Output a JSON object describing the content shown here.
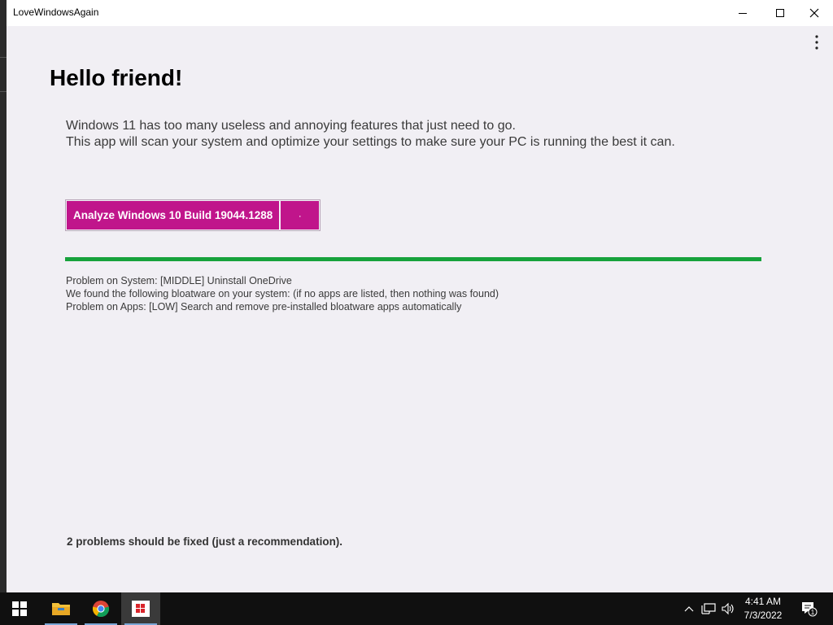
{
  "window": {
    "title": "LoveWindowsAgain"
  },
  "main": {
    "heading": "Hello friend!",
    "intro_line1": "Windows 11 has too many useless and annoying features that just need to go.",
    "intro_line2": "This app will scan your system and optimize your settings to make sure your PC is running the best it can.",
    "analyze_label": "Analyze Windows 10 Build 19044.1288",
    "secondary_label": "·",
    "progress_percent": 100,
    "log": [
      "Problem on System: [MIDDLE] Uninstall OneDrive",
      "We found the following bloatware on your system: (if no apps are listed, then nothing was found)",
      "Problem on Apps: [LOW] Search and remove pre-installed bloatware apps automatically"
    ],
    "summary": "2 problems should be fixed (just a recommendation)."
  },
  "taskbar": {
    "apps": [
      "start-icon",
      "file-explorer-icon",
      "chrome-icon",
      "love-windows-again-icon"
    ],
    "time": "4:41 AM",
    "date": "7/3/2022",
    "notification_count": "1"
  },
  "colors": {
    "accent": "#c0158b",
    "progress": "#17a23c",
    "window_bg": "#f1eff4"
  }
}
